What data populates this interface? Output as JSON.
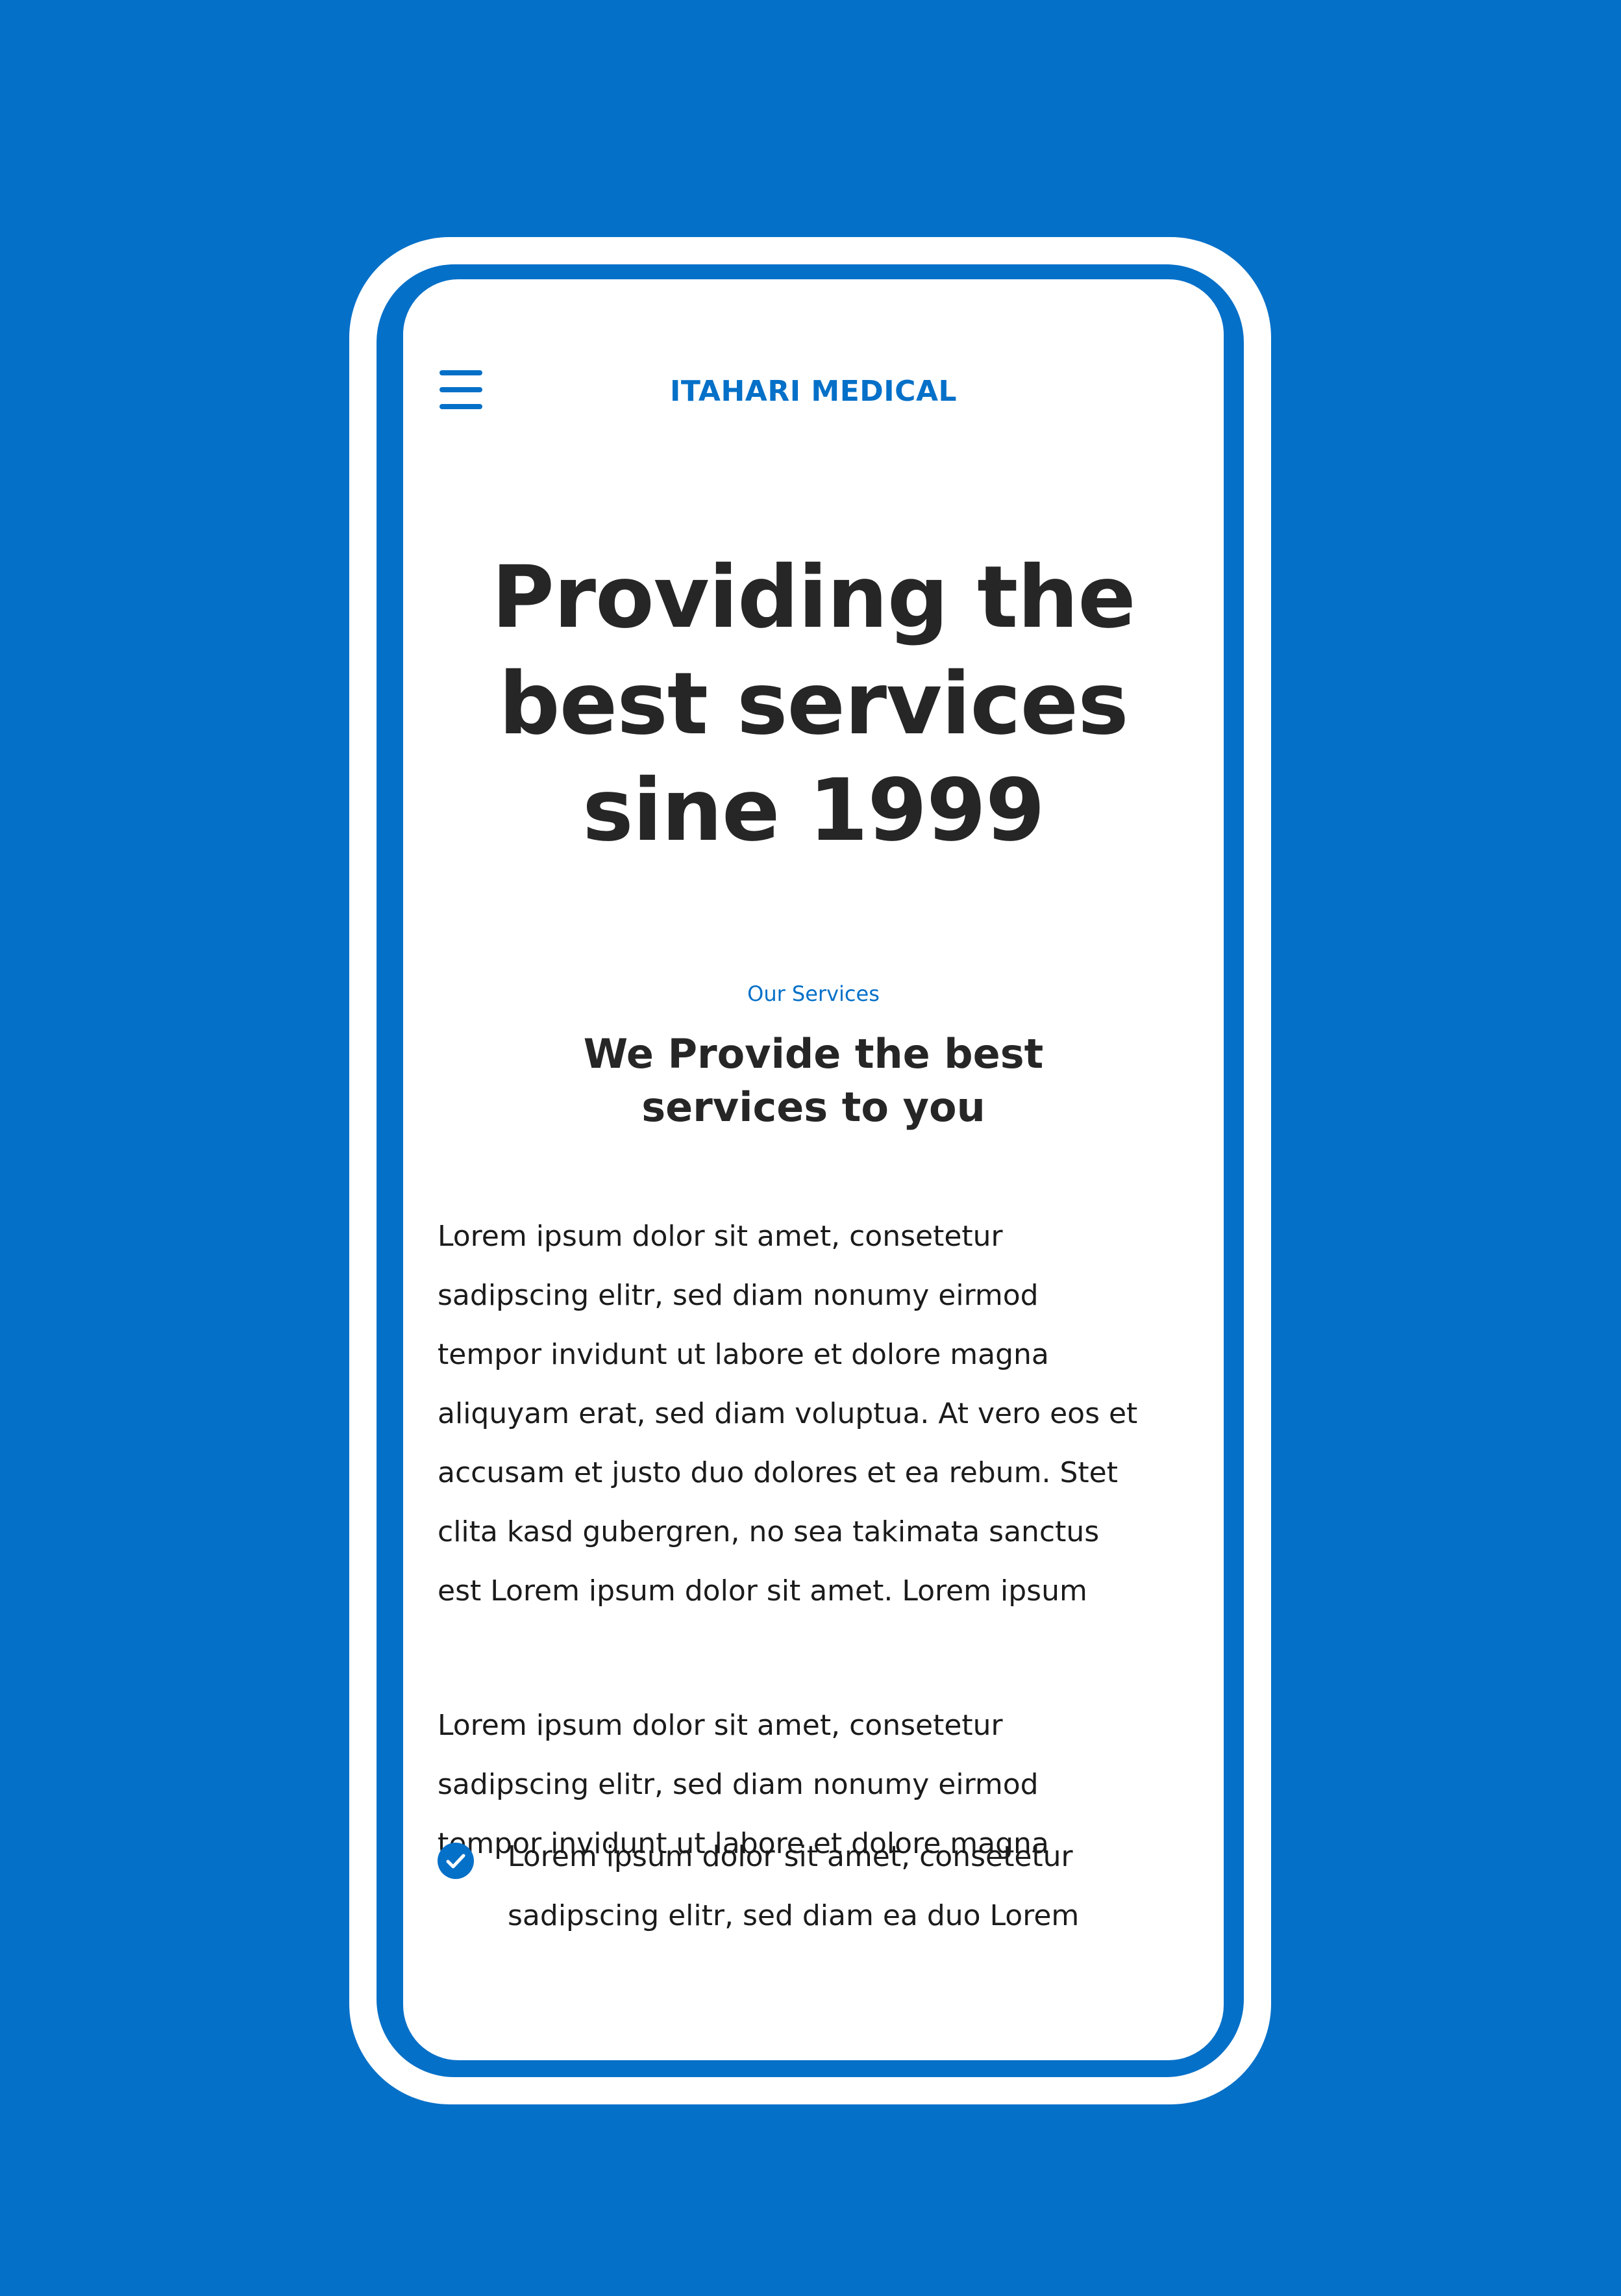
{
  "colors": {
    "background": "#0570c8",
    "accent": "#0570c8",
    "screen": "#ffffff",
    "heading_text": "#262626",
    "body_text": "#1b1b1b"
  },
  "header": {
    "menu_icon": "hamburger-menu-icon",
    "brand": "ITAHARI MEDICAL"
  },
  "hero": {
    "title_lines": [
      "Providing the",
      "best services",
      "sine 1999"
    ]
  },
  "services": {
    "eyebrow": "Our Services",
    "title_lines": [
      "We Provide the best",
      "services to you"
    ],
    "paragraph_1_lines": [
      "Lorem ipsum dolor sit amet, consetetur",
      "sadipscing elitr, sed diam nonumy eirmod",
      "tempor invidunt ut labore et dolore magna",
      "aliquyam erat, sed diam voluptua. At vero eos et",
      "accusam et justo duo dolores et ea rebum. Stet",
      "clita kasd gubergren, no sea takimata sanctus",
      "est Lorem ipsum dolor sit amet. Lorem ipsum"
    ],
    "paragraph_2_lines": [
      "Lorem ipsum dolor sit amet, consetetur",
      "sadipscing elitr, sed diam nonumy eirmod",
      "tempor invidunt ut labore et dolore magna"
    ],
    "check_items": [
      {
        "icon": "check-circle-icon",
        "lines": [
          "Lorem ipsum dolor sit amet, consetetur",
          "sadipscing elitr, sed diam  ea duo Lorem"
        ]
      }
    ]
  }
}
